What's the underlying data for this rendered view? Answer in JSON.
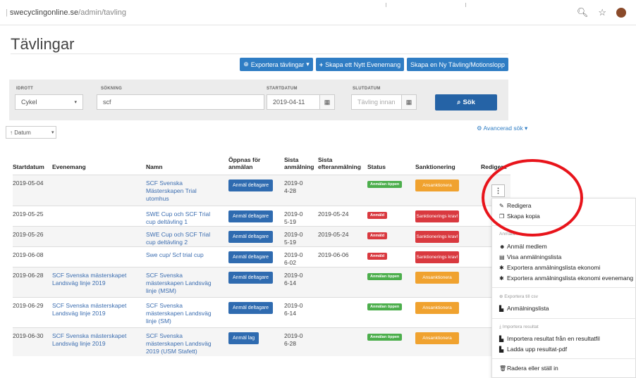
{
  "browser": {
    "url_domain": "swecyclingonline.se",
    "url_path": "/admin/tavling",
    "icons": [
      "zoom-icon",
      "star-icon"
    ]
  },
  "page": {
    "title": "Tävlingar"
  },
  "toolbar": {
    "export_label": "Exportera tävlingar",
    "create_event_label": "Skapa ett Nytt Evenemang",
    "create_comp_label": "Skapa en Ny Tävling/Motionslopp"
  },
  "filters": {
    "sport_label": "IDROTT",
    "sport_value": "Cykel",
    "search_label": "SÖKNING",
    "search_value": "scf",
    "start_label": "STARTDATUM",
    "start_value": "2019-04-11",
    "end_label": "SLUTDATUM",
    "end_placeholder": "Tävling innan",
    "search_button": "Sök"
  },
  "sort": {
    "value": "↑ Datum"
  },
  "advanced_search": "Avancerad sök",
  "table": {
    "headers": {
      "start": "Startdatum",
      "event": "Evenemang",
      "name": "Namn",
      "open_1": "Öppnas för",
      "open_2": "anmälan",
      "last_1": "Sista",
      "last_2": "anmälning",
      "late_1": "Sista",
      "late_2": "efteranmälning",
      "status": "Status",
      "sanction": "Sanktionering",
      "edit": "Redigera"
    },
    "rows": [
      {
        "start": "2019-05-04",
        "event": "",
        "name": "SCF Svenska Mästerskapen Trial utomhus",
        "open": "Anmäl deltagare",
        "last": "2019-04-28",
        "late": "",
        "status": "Anmälan öppen",
        "sanction": "Ansanktionera"
      },
      {
        "start": "2019-05-25",
        "event": "",
        "name": "SWE Cup och SCF Trial cup deltävling 1",
        "open": "Anmäl deltagare",
        "last": "2019-05-19",
        "late": "2019-05-24",
        "status": "Anmäld",
        "sanction": "Sanktionerings krav!"
      },
      {
        "start": "2019-05-26",
        "event": "",
        "name": "SWE Cup och SCF Trial cup deltävling 2",
        "open": "Anmäl deltagare",
        "last": "2019-05-19",
        "late": "2019-05-24",
        "status": "Anmäld",
        "sanction": "Sanktionerings krav!"
      },
      {
        "start": "2019-06-08",
        "event": "",
        "name": "Swe cup/ Scf trial cup",
        "open": "Anmäl deltagare",
        "last": "2019-06-02",
        "late": "2019-06-06",
        "status": "Anmäld",
        "sanction": "Sanktionerings krav!"
      },
      {
        "start": "2019-06-28",
        "event": "SCF Svenska mästerskapet Landsväg linje 2019",
        "name": "SCF Svenska mästerskapen Landsväg linje (MSM)",
        "open": "Anmäl deltagare",
        "last": "2019-06-14",
        "late": "",
        "status": "Anmälan öppen",
        "sanction": "Ansanktionera"
      },
      {
        "start": "2019-06-29",
        "event": "SCF Svenska mästerskapet Landsväg linje 2019",
        "name": "SCF Svenska mästerskapen Landsväg linje (SM)",
        "open": "Anmäl deltagare",
        "last": "2019-06-14",
        "late": "",
        "status": "Anmälan öppen",
        "sanction": "Ansanktionera"
      },
      {
        "start": "2019-06-30",
        "event": "SCF Svenska mästerskapet Landsväg linje 2019",
        "name": "SCF Svenska mästerskapen Landsväg 2019 (USM Stafett)",
        "open": "Anmäl lag",
        "last": "2019-06-28",
        "late": "",
        "status": "Anmälan öppen",
        "sanction": "Ansanktionera"
      }
    ]
  },
  "menu": {
    "kebab": "⋮",
    "edit": "Redigera",
    "copy": "Skapa kopia",
    "header_register": "Anmälan",
    "register_member": "Anmäl medlem",
    "show_list": "Visa anmälningslista",
    "export_economy": "Exportera anmälningslista ekonomi",
    "export_economy_event": "Exportera anmälningslista ekonomi evenemang",
    "header_csv": "Exportera till csv",
    "csv_list": "Anmälningslista",
    "header_import": "Importera resultat",
    "import_file": "Importera resultat från en resultatfil",
    "upload_pdf": "Ladda upp resultat-pdf",
    "delete": "Radera eller ställ in"
  },
  "colors": {
    "primary": "#2f7dc4",
    "status_open": "#4cae4c",
    "status_closed": "#d9393f",
    "sanction_orange": "#f0a22f",
    "annotation_circle": "#e8141b"
  }
}
